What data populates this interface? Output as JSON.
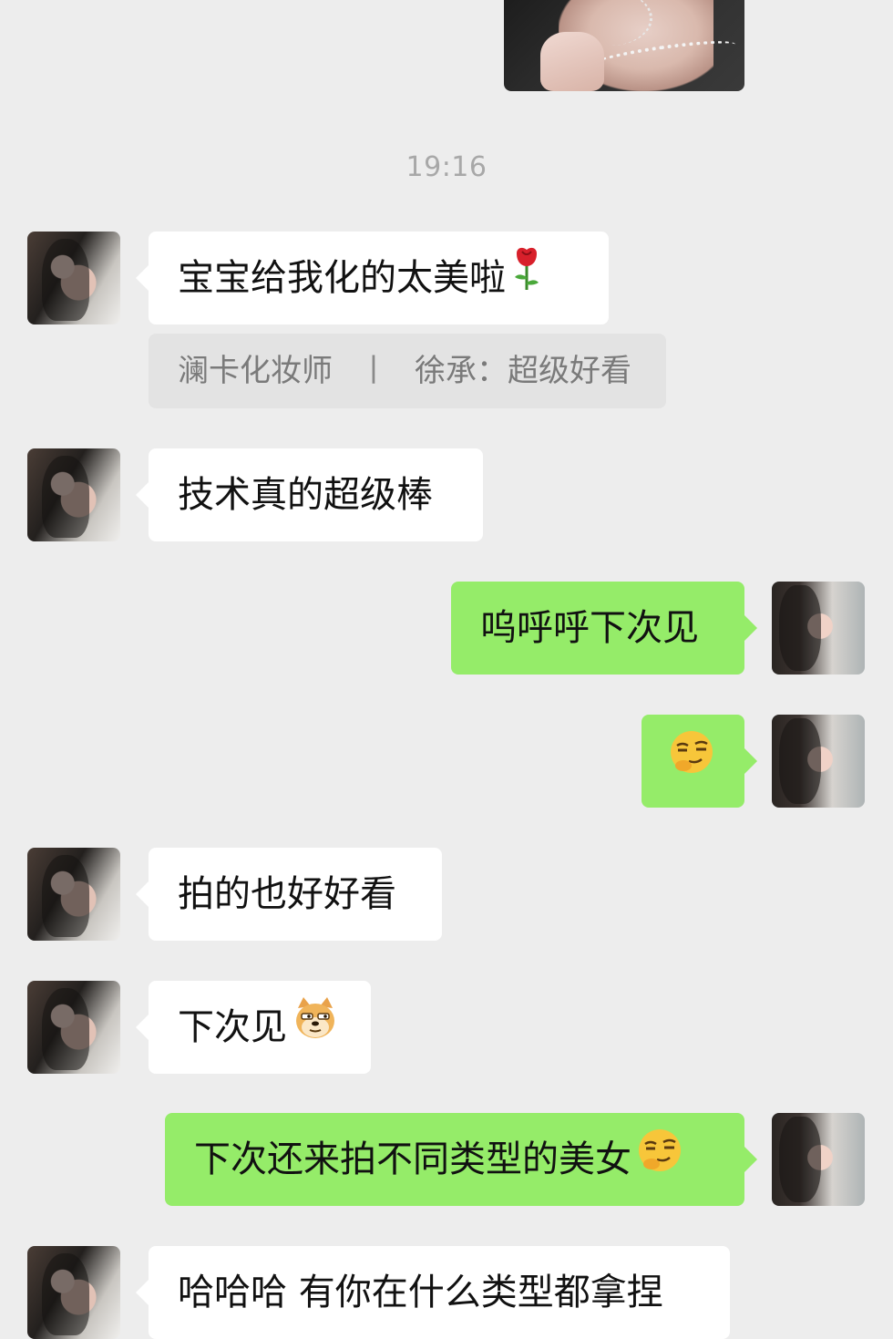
{
  "timestamp": "19:16",
  "quote": {
    "sender": "澜卡化妆师",
    "separator": "丨",
    "content": "徐承：超级好看"
  },
  "messages": [
    {
      "side": "in",
      "text": "宝宝给我化的太美啦",
      "emoji": "rose-emoji"
    },
    {
      "side": "in",
      "text": "技术真的超级棒"
    },
    {
      "side": "out",
      "text": "呜呼呼下次见"
    },
    {
      "side": "out",
      "text": "",
      "emoji": "smirk-emoji"
    },
    {
      "side": "in",
      "text": "拍的也好好看"
    },
    {
      "side": "in",
      "text": "下次见",
      "emoji": "doge-emoji"
    },
    {
      "side": "out",
      "text": "下次还来拍不同类型的美女",
      "emoji": "smirk-emoji"
    },
    {
      "side": "in",
      "text": "哈哈哈 有你在什么类型都拿捏"
    }
  ],
  "colors": {
    "background": "#ededed",
    "incoming_bubble": "#ffffff",
    "outgoing_bubble": "#95ec69",
    "timestamp_text": "#a8a8a8",
    "quote_bg": "#e3e3e3"
  }
}
